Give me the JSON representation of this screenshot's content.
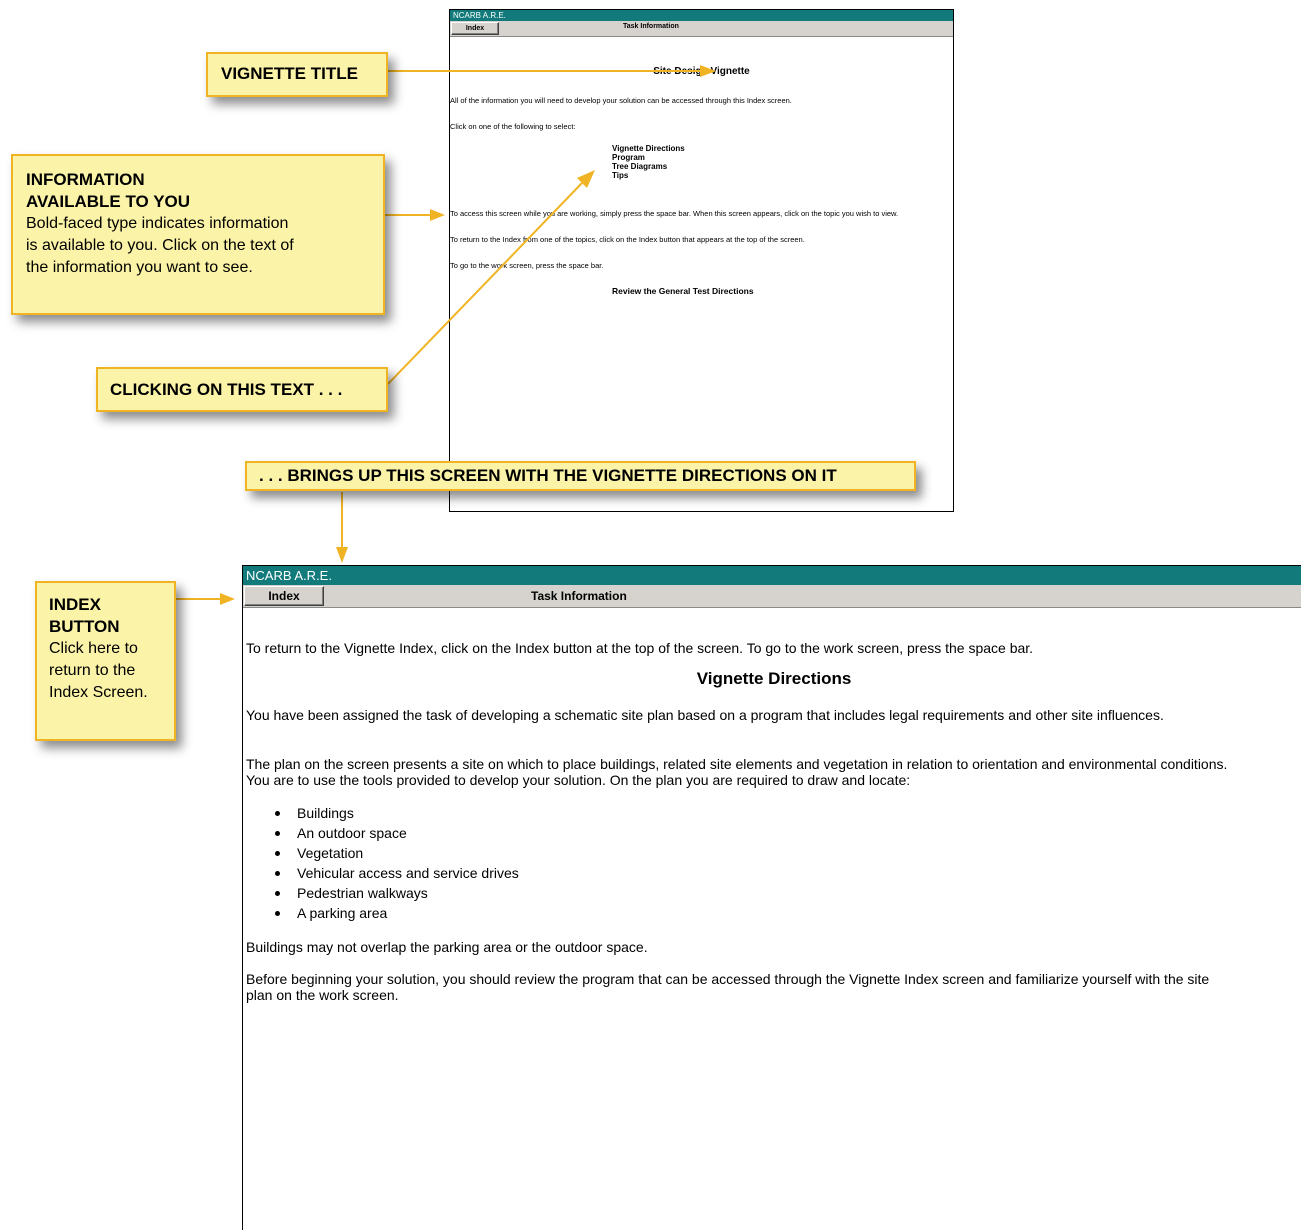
{
  "screen1": {
    "titlebar": "NCARB A.R.E.",
    "index_button": "Index",
    "task_label": "Task Information",
    "heading": "Site Design Vignette",
    "intro": "All of the information you will need to develop your solution can be accessed through this Index screen.",
    "select_prompt": "Click on one of the following to select:",
    "links": [
      "Vignette Directions",
      "Program",
      "Tree Diagrams",
      "Tips"
    ],
    "space_note": "To access this screen while you are working, simply press the space bar.  When this screen appears, click on the topic you wish to view.",
    "return_note": "To return to the Index from one of the topics, click on the Index button that appears at the top of the screen.",
    "work_note": "To go to the work screen, press the space bar.",
    "review_link": "Review the General Test Directions"
  },
  "screen2": {
    "titlebar": "NCARB A.R.E.",
    "index_button": "Index",
    "task_label": "Task Information",
    "return_text": "To return to the Vignette Index, click on the Index button at the top of the screen.  To go to the work screen, press the space bar.",
    "heading": "Vignette Directions",
    "para1": "You have been assigned the task of developing a schematic site plan based on a program that includes legal requirements and other site influences.",
    "para2": "The plan on the screen presents a site on which to place buildings, related site elements and vegetation in relation to orientation and environmental conditions.  You are to use the tools provided to develop your solution.  On the plan you are required to draw and locate:",
    "bullets": [
      "Buildings",
      "An outdoor space",
      "Vegetation",
      "Vehicular access and service drives",
      "Pedestrian walkways",
      "A parking area"
    ],
    "para3": "Buildings may not overlap the parking area or the outdoor space.",
    "para4": "Before beginning your solution, you should review the program that can be accessed through the Vignette Index screen and familiarize yourself with the site plan on the work screen."
  },
  "callouts": {
    "vignette_title": "VIGNETTE TITLE",
    "info_title_1": "INFORMATION",
    "info_title_2": "AVAILABLE TO YOU",
    "info_body_1": "Bold-faced type indicates information",
    "info_body_2": "is available to you. Click on the text of",
    "info_body_3": "the information you want to see.",
    "clicking": "CLICKING ON THIS TEXT . . .",
    "brings": ". . . BRINGS UP THIS SCREEN WITH THE VIGNETTE DIRECTIONS ON IT",
    "index_title_1": "INDEX",
    "index_title_2": "BUTTON",
    "index_body_1": "Click here to",
    "index_body_2": "return to the",
    "index_body_3": "Index Screen."
  },
  "colors": {
    "titlebar": "#127a7a",
    "callout_fill": "#fbf3a7",
    "callout_border": "#f0b323",
    "arrow": "#f0b323"
  }
}
